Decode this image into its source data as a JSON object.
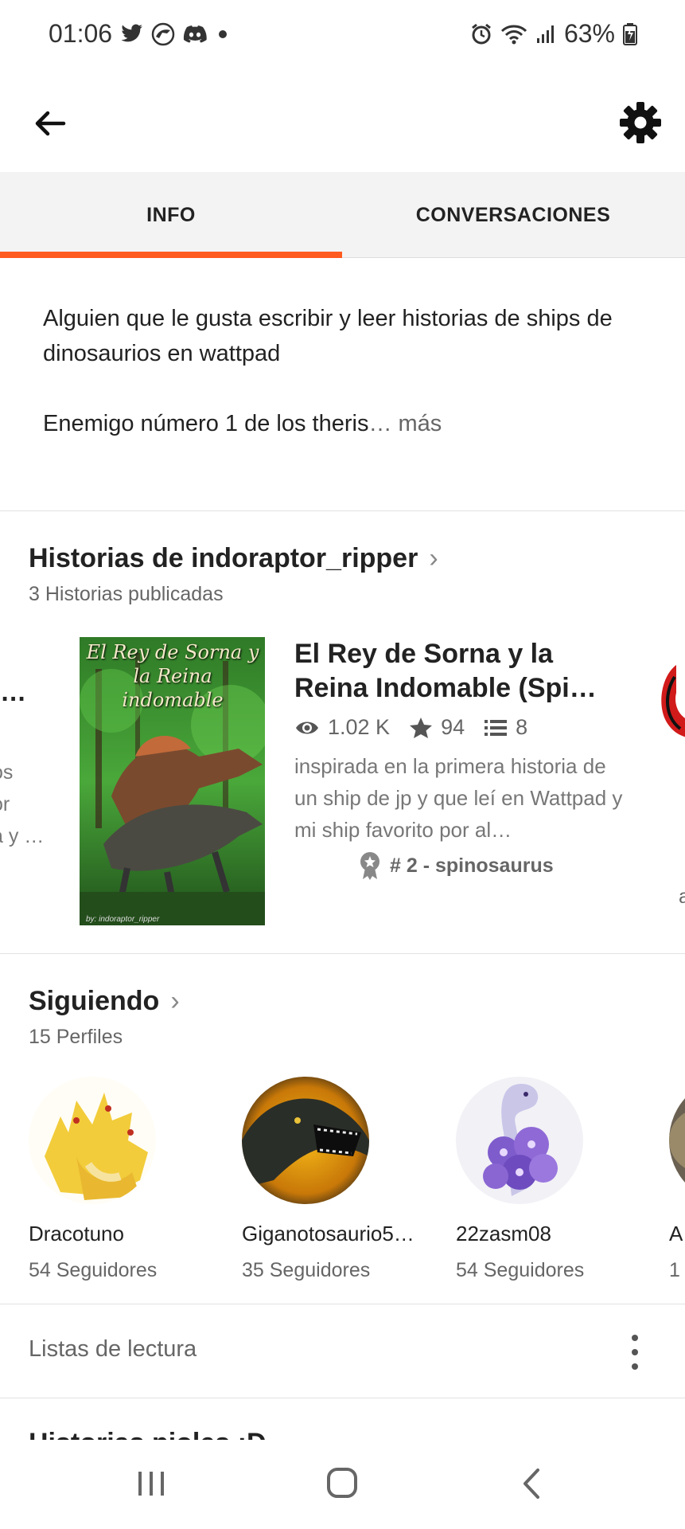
{
  "status_bar": {
    "time": "01:06",
    "battery": "63%",
    "left_icons": [
      "twitter-icon",
      "jurassic-logo-icon",
      "discord-icon",
      "dot-icon"
    ],
    "right_icons": [
      "alarm-icon",
      "wifi-icon",
      "signal-icon",
      "battery-icon"
    ]
  },
  "app_bar": {
    "back_icon": "arrow-left-icon",
    "settings_icon": "gear-icon"
  },
  "tabs": [
    {
      "label": "INFO",
      "active": true
    },
    {
      "label": "CONVERSACIONES",
      "active": false
    }
  ],
  "about": {
    "line1": "Alguien que le gusta escribir y leer historias de ships de dinosaurios en wattpad",
    "line2": "Enemigo número 1 de los theris",
    "ellipsis": "…",
    "more": " más"
  },
  "stories": {
    "title": "Historias de indoraptor_ripper",
    "subtitle": "3 Historias publicadas",
    "prev_card": {
      "title_fragment": "n…",
      "desc_fragments": [
        "os",
        "or",
        "a y …"
      ]
    },
    "story": {
      "cover_title": "El Rey de Sorna y la Reina indomable",
      "cover_credit": "by: indoraptor_ripper",
      "title": "El Rey de Sorna y la Reina Indomable (Spi…",
      "reads": "1.02 K",
      "votes": "94",
      "parts": "8",
      "description": "inspirada en la primera historia de un ship de jp y que leí en Wattpad y mi ship favorito por al…",
      "rank": "# 2 - spinosaurus"
    },
    "next_fragment": "a"
  },
  "following": {
    "title": "Siguiendo",
    "subtitle": "15 Perfiles",
    "profiles": [
      {
        "name": "Dracotuno",
        "followers": "54 Seguidores"
      },
      {
        "name": "Giganotosaurio5…",
        "followers": "35 Seguidores"
      },
      {
        "name": "22zasm08",
        "followers": "54 Seguidores"
      },
      {
        "name": "A",
        "followers": "1"
      }
    ]
  },
  "reading_lists": {
    "label": "Listas de lectura",
    "menu_icon": "more-vertical-icon",
    "cut_title": "Historias pioles :D"
  },
  "nav_bar": {
    "icons": [
      "recent-apps-icon",
      "home-icon",
      "back-icon"
    ]
  },
  "colors": {
    "accent": "#ff5a1f",
    "tab_bg": "#f3f3f3",
    "text": "#222222",
    "muted": "#666666"
  }
}
